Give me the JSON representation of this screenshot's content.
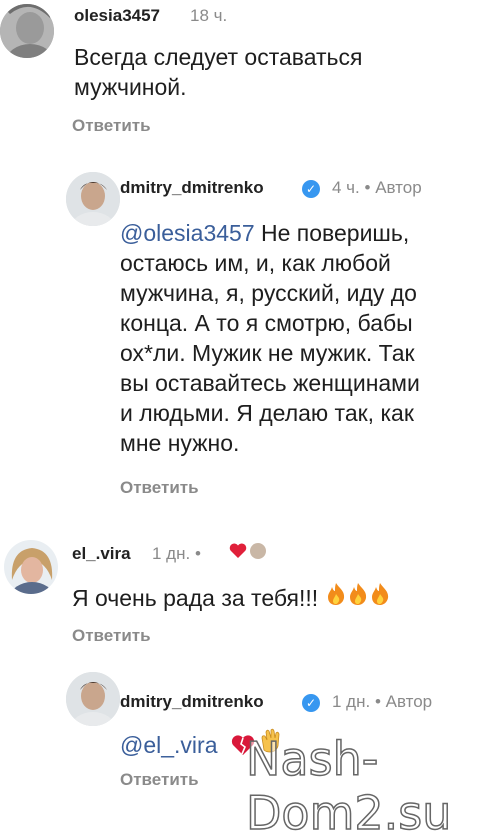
{
  "comments": [
    {
      "username": "olesia3457",
      "time": "18 ч.",
      "text_lines": [
        "Всегда следует оставаться",
        "мужчиной."
      ],
      "reply_label": "Ответить"
    },
    {
      "username": "dmitry_dmitrenko",
      "time": "4 ч.",
      "author_label": "Автор",
      "mention": "@olesia3457",
      "text_lines": [
        " Не поверишь,",
        "остаюсь им, и, как любой",
        "мужчина, я, русский, иду до",
        "конца. А то я смотрю, бабы",
        "ох*ли. Мужик не мужик. Так",
        "вы оставайтесь женщинами",
        "и людьми. Я делаю так, как",
        "мне нужно."
      ],
      "reply_label": "Ответить"
    },
    {
      "username": "el_.vira",
      "time": "1 дн.",
      "text": "Я очень рада за тебя!!!",
      "reply_label": "Ответить"
    },
    {
      "username": "dmitry_dmitrenko",
      "time": "1 дн.",
      "author_label": "Автор",
      "mention": "@el_.vira",
      "reply_label": "Ответить"
    }
  ],
  "separator": "•",
  "watermark": "Nash-Dom2.su",
  "icons": {
    "verified": "verified-badge-icon",
    "heart": "red-heart-icon",
    "fire": "fire-emoji-icon",
    "broken_heart": "heart-emoji-icon",
    "clap": "clapping-hands-icon"
  }
}
